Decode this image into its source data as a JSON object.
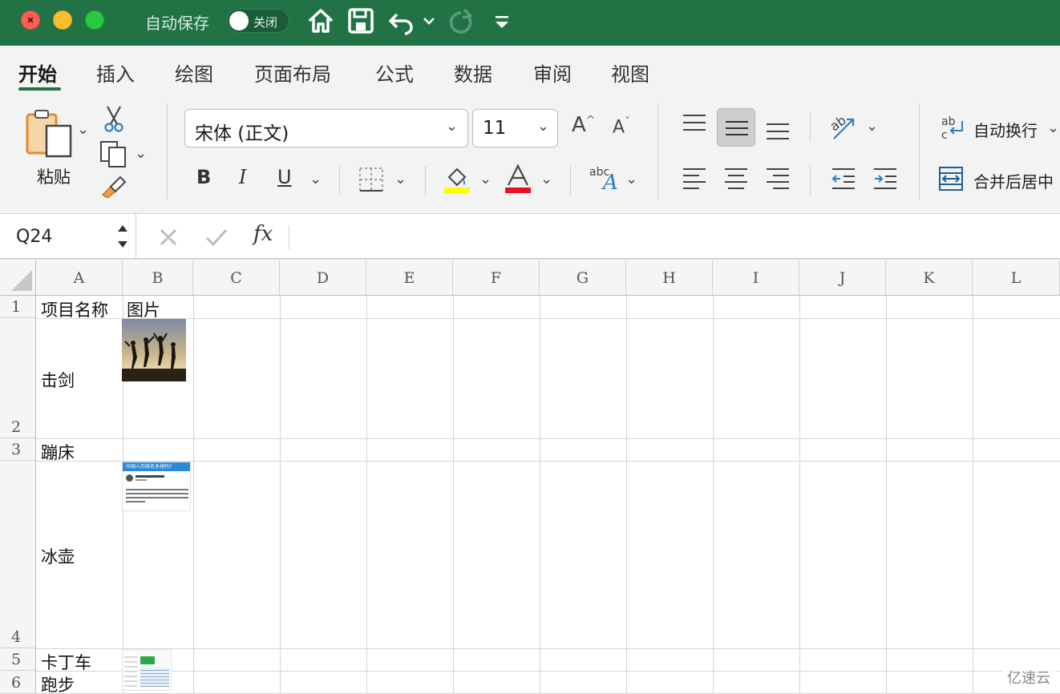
{
  "titlebar": {
    "autosave_label": "自动保存",
    "autosave_state": "关闭",
    "icons": [
      "home-icon",
      "save-icon",
      "undo-icon",
      "redo-icon",
      "customize-icon"
    ]
  },
  "tabs": [
    "开始",
    "插入",
    "绘图",
    "页面布局",
    "公式",
    "数据",
    "审阅",
    "视图"
  ],
  "active_tab": "开始",
  "ribbon": {
    "paste_label": "粘贴",
    "font_name": "宋体 (正文)",
    "font_size": "11",
    "bold": "B",
    "italic": "I",
    "underline": "U",
    "wrap_text": "自动换行",
    "merge_center": "合并后居中",
    "abc": "abc",
    "fill_color": "#ffff00",
    "font_color": "#e81123"
  },
  "formula_bar": {
    "name_box": "Q24",
    "fx": "fx",
    "formula": ""
  },
  "sheet": {
    "columns": [
      "A",
      "B",
      "C",
      "D",
      "E",
      "F",
      "G",
      "H",
      "I",
      "J",
      "K",
      "L"
    ],
    "rows": [
      "1",
      "2",
      "3",
      "4",
      "5",
      "6"
    ],
    "cells": {
      "A1": "项目名称",
      "B1": "图片",
      "A2": "击剑",
      "A3": "蹦床",
      "A4": "冰壶",
      "A5": "卡丁车",
      "A6": "跑步"
    },
    "image_text": "中国人的排名多排吗?"
  },
  "watermark": "亿速云",
  "colors": {
    "brand": "#217346"
  }
}
